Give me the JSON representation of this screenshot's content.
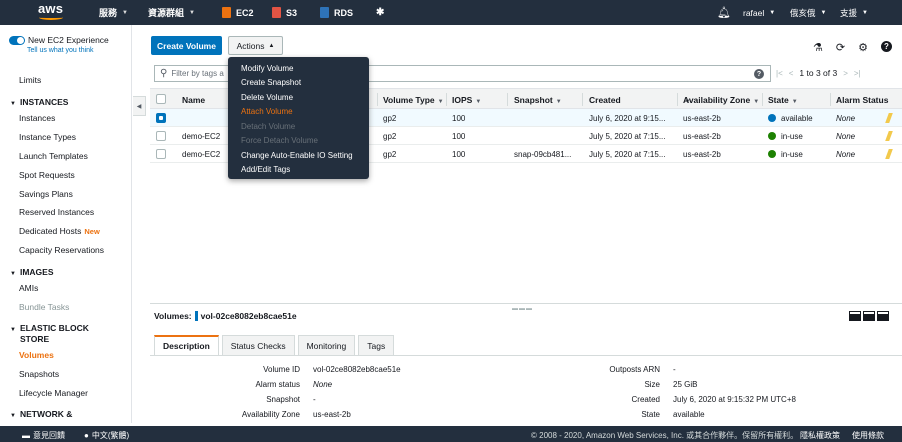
{
  "nav": {
    "logo": "aws",
    "services": "服務",
    "resource_groups": "資源群組",
    "ec2": "EC2",
    "s3": "S3",
    "rds": "RDS",
    "user": "rafael",
    "region": "俄亥俄",
    "support": "支援",
    "colors": {
      "ec2": "#ec7211",
      "s3": "#e25444",
      "rds": "#2e73b8"
    }
  },
  "sidebar": {
    "toggle_label": "New EC2 Experience",
    "tell_us": "Tell us what you think",
    "limits": "Limits",
    "instances_head": "INSTANCES",
    "instances": "Instances",
    "instance_types": "Instance Types",
    "launch_templates": "Launch Templates",
    "spot_requests": "Spot Requests",
    "savings_plans": "Savings Plans",
    "reserved_instances": "Reserved Instances",
    "dedicated_hosts": "Dedicated Hosts",
    "new_badge": "New",
    "capacity_reservations": "Capacity Reservations",
    "images_head": "IMAGES",
    "amis": "AMIs",
    "bundle_tasks": "Bundle Tasks",
    "ebs_head_1": "ELASTIC BLOCK",
    "ebs_head_2": "STORE",
    "volumes": "Volumes",
    "snapshots": "Snapshots",
    "lifecycle_manager": "Lifecycle Manager",
    "network_head": "NETWORK &"
  },
  "toolbar": {
    "create_volume": "Create Volume",
    "actions": "Actions"
  },
  "filter": {
    "placeholder": "Filter by tags a",
    "pager": "1 to 3 of 3"
  },
  "actions_menu": [
    {
      "label": "Modify Volume",
      "state": "normal"
    },
    {
      "label": "Create Snapshot",
      "state": "normal"
    },
    {
      "label": "Delete Volume",
      "state": "normal"
    },
    {
      "label": "Attach Volume",
      "state": "highlight"
    },
    {
      "label": "Detach Volume",
      "state": "disabled"
    },
    {
      "label": "Force Detach Volume",
      "state": "disabled"
    },
    {
      "label": "Change Auto-Enable IO Setting",
      "state": "normal"
    },
    {
      "label": "Add/Edit Tags",
      "state": "normal"
    }
  ],
  "table": {
    "headers": {
      "name": "Name",
      "volume_type": "Volume Type",
      "iops": "IOPS",
      "snapshot": "Snapshot",
      "created": "Created",
      "az": "Availability Zone",
      "state": "State",
      "alarm": "Alarm Status"
    },
    "rows": [
      {
        "name": "",
        "type": "gp2",
        "iops": "100",
        "snapshot": "",
        "created": "July 6, 2020 at 9:15...",
        "az": "us-east-2b",
        "state": "available",
        "state_color": "#0073bb",
        "alarm": "None",
        "selected": true
      },
      {
        "name": "demo-EC2",
        "type": "gp2",
        "iops": "100",
        "snapshot": "",
        "created": "July 5, 2020 at 7:15...",
        "az": "us-east-2b",
        "state": "in-use",
        "state_color": "#1d8102",
        "alarm": "None",
        "selected": false
      },
      {
        "name": "demo-EC2",
        "type": "gp2",
        "iops": "100",
        "snapshot": "snap-09cb481...",
        "created": "July 5, 2020 at 7:15...",
        "az": "us-east-2b",
        "state": "in-use",
        "state_color": "#1d8102",
        "alarm": "None",
        "selected": false
      }
    ]
  },
  "details": {
    "title_prefix": "Volumes:",
    "volume_id": "vol-02ce8082eb8cae51e",
    "tabs": [
      "Description",
      "Status Checks",
      "Monitoring",
      "Tags"
    ],
    "left": [
      {
        "k": "Volume ID",
        "v": "vol-02ce8082eb8cae51e"
      },
      {
        "k": "Alarm status",
        "v": "None"
      },
      {
        "k": "Snapshot",
        "v": "-"
      },
      {
        "k": "Availability Zone",
        "v": "us-east-2b"
      }
    ],
    "right": [
      {
        "k": "Outposts ARN",
        "v": "-"
      },
      {
        "k": "Size",
        "v": "25 GiB"
      },
      {
        "k": "Created",
        "v": "July 6, 2020 at 9:15:32 PM UTC+8"
      },
      {
        "k": "State",
        "v": "available"
      }
    ]
  },
  "footer": {
    "feedback": "意見回饋",
    "language": "中文(繁體)",
    "copyright": "© 2008 - 2020, Amazon Web Services, Inc. 或其合作夥伴。保留所有權利。",
    "privacy": "隱私權政策",
    "terms": "使用條款"
  }
}
